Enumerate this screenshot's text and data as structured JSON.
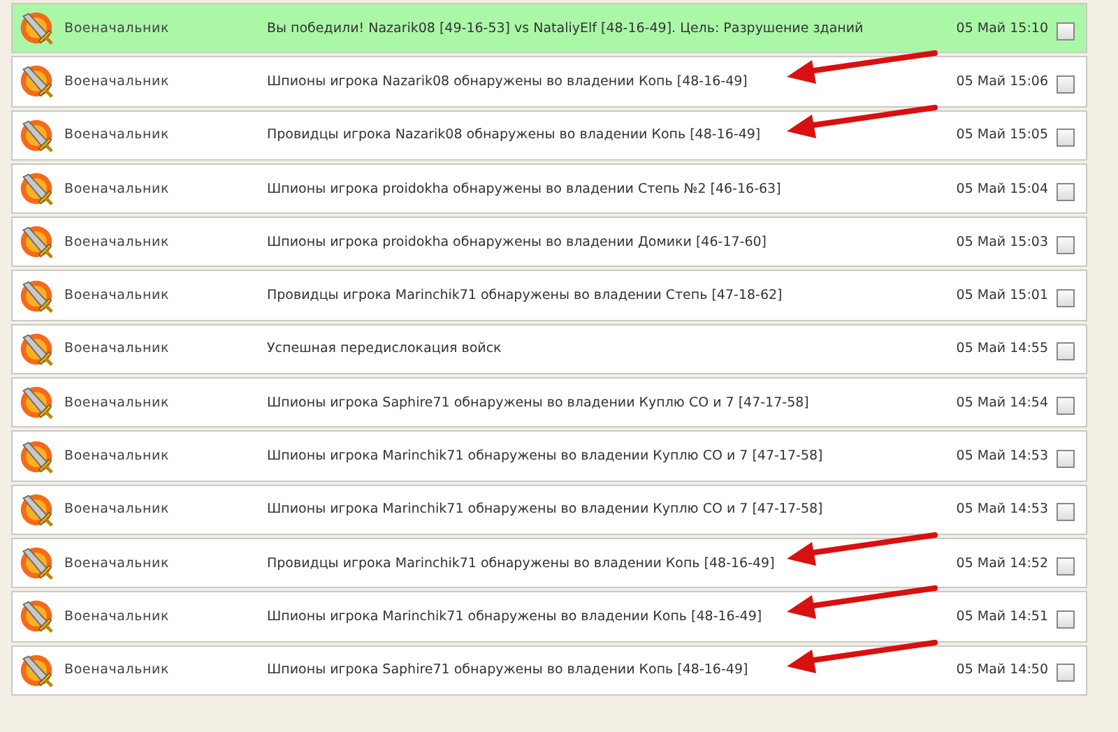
{
  "messages": [
    {
      "sender": "Военачальник",
      "text": "Вы победили! Nazarik08 [49-16-53] vs NataliyElf [48-16-49]. Цель: Разрушение зданий",
      "time": "05 Май 15:10",
      "kind": "victory",
      "checked": false,
      "annotated": false
    },
    {
      "sender": "Военачальник",
      "text": "Шпионы игрока Nazarik08 обнаружены во владении Копь [48-16-49]",
      "time": "05 Май 15:06",
      "kind": "report",
      "checked": false,
      "annotated": true
    },
    {
      "sender": "Военачальник",
      "text": "Провидцы игрока Nazarik08 обнаружены во владении Копь [48-16-49]",
      "time": "05 Май 15:05",
      "kind": "report",
      "checked": false,
      "annotated": true
    },
    {
      "sender": "Военачальник",
      "text": "Шпионы игрока proidokha обнаружены во владении Степь №2 [46-16-63]",
      "time": "05 Май 15:04",
      "kind": "report",
      "checked": false,
      "annotated": false
    },
    {
      "sender": "Военачальник",
      "text": "Шпионы игрока proidokha обнаружены во владении Домики [46-17-60]",
      "time": "05 Май 15:03",
      "kind": "report",
      "checked": false,
      "annotated": false
    },
    {
      "sender": "Военачальник",
      "text": "Провидцы игрока Marinchik71 обнаружены во владении Степь [47-18-62]",
      "time": "05 Май 15:01",
      "kind": "report",
      "checked": false,
      "annotated": false
    },
    {
      "sender": "Военачальник",
      "text": "Успешная передислокация войск",
      "time": "05 Май 14:55",
      "kind": "report",
      "checked": false,
      "annotated": false
    },
    {
      "sender": "Военачальник",
      "text": "Шпионы игрока Saphire71 обнаружены во владении Куплю СО и 7 [47-17-58]",
      "time": "05 Май 14:54",
      "kind": "report",
      "checked": false,
      "annotated": false
    },
    {
      "sender": "Военачальник",
      "text": "Шпионы игрока Marinchik71 обнаружены во владении Куплю СО и 7 [47-17-58]",
      "time": "05 Май 14:53",
      "kind": "report",
      "checked": false,
      "annotated": false
    },
    {
      "sender": "Военачальник",
      "text": "Шпионы игрока Marinchik71 обнаружены во владении Куплю СО и 7 [47-17-58]",
      "time": "05 Май 14:53",
      "kind": "report",
      "checked": false,
      "annotated": false
    },
    {
      "sender": "Военачальник",
      "text": "Провидцы игрока Marinchik71 обнаружены во владении Копь [48-16-49]",
      "time": "05 Май 14:52",
      "kind": "report",
      "checked": false,
      "annotated": true
    },
    {
      "sender": "Военачальник",
      "text": "Шпионы игрока Marinchik71 обнаружены во владении Копь [48-16-49]",
      "time": "05 Май 14:51",
      "kind": "report",
      "checked": false,
      "annotated": true
    },
    {
      "sender": "Военачальник",
      "text": "Шпионы игрока Saphire71 обнаружены во владении Копь [48-16-49]",
      "time": "05 Май 14:50",
      "kind": "report",
      "checked": false,
      "annotated": true
    }
  ]
}
